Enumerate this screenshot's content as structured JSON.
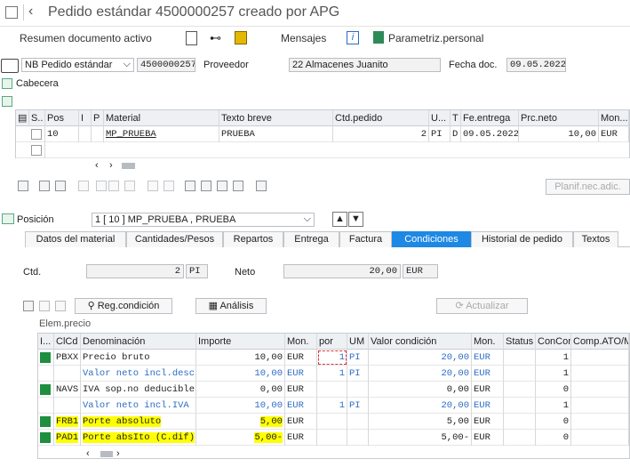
{
  "header": {
    "title": "Pedido estándar 4500000257 creado por APG"
  },
  "toolbar": {
    "resumen": "Resumen documento activo",
    "mensajes": "Mensajes",
    "parametriz": "Parametriz.personal"
  },
  "header_fields": {
    "doc_type": "NB Pedido estándar",
    "doc_number": "4500000257",
    "vendor_label": "Proveedor",
    "vendor_value": "22 Almacenes Juanito",
    "date_label": "Fecha doc.",
    "date_value": "09.05.2022",
    "cabecera": "Cabecera"
  },
  "items_table": {
    "columns": [
      "S..",
      "Pos",
      "I",
      "P",
      "Material",
      "Texto breve",
      "Ctd.pedido",
      "U...",
      "T",
      "Fe.entrega",
      "Prc.neto",
      "Mon..."
    ],
    "rows": [
      {
        "pos": "10",
        "material": "MP_PRUEBA",
        "texto": "PRUEBA",
        "ctd": "2",
        "u": "PI",
        "t": "D",
        "fecha": "09.05.2022",
        "precio": "10,00",
        "mon": "EUR"
      }
    ],
    "planif": "Planif.nec.adic."
  },
  "position": {
    "label": "Posición",
    "value": "1 [ 10 ] MP_PRUEBA , PRUEBA"
  },
  "tabs": [
    "Datos del material",
    "Cantidades/Pesos",
    "Repartos",
    "Entrega",
    "Factura",
    "Condiciones",
    "Historial de pedido",
    "Textos"
  ],
  "active_tab": "Condiciones",
  "conditions": {
    "ctd_label": "Ctd.",
    "ctd_value": "2",
    "ctd_unit": "PI",
    "neto_label": "Neto",
    "neto_value": "20,00",
    "neto_unit": "EUR",
    "reg_condicion": "Reg.condición",
    "analisis": "Análisis",
    "actualizar": "Actualizar",
    "elem_precio": "Elem.precio",
    "columns": [
      "I...",
      "ClCd",
      "Denominación",
      "Importe",
      "Mon.",
      "por",
      "UM",
      "Valor condición",
      "Mon.",
      "Status",
      "ConCon",
      "Comp.ATO/M"
    ],
    "rows": [
      {
        "green": true,
        "yellow": false,
        "clcd": "PBXX",
        "den": "Precio bruto",
        "imp": "10,00",
        "mon": "EUR",
        "por": "1",
        "um": "PI",
        "valor": "20,00",
        "mon2": "EUR",
        "concon": "1",
        "blue": false,
        "blueval": true
      },
      {
        "green": false,
        "yellow": false,
        "clcd": "",
        "den": "Valor neto incl.desc",
        "imp": "10,00",
        "mon": "EUR",
        "por": "1",
        "um": "PI",
        "valor": "20,00",
        "mon2": "EUR",
        "concon": "1",
        "blue": true,
        "blueval": true
      },
      {
        "green": true,
        "yellow": false,
        "clcd": "NAVS",
        "den": "IVA sop.no deducible",
        "imp": "0,00",
        "mon": "EUR",
        "por": "",
        "um": "",
        "valor": "0,00",
        "mon2": "EUR",
        "concon": "0",
        "blue": false,
        "blueval": false
      },
      {
        "green": false,
        "yellow": false,
        "clcd": "",
        "den": "Valor neto incl.IVA",
        "imp": "10,00",
        "mon": "EUR",
        "por": "1",
        "um": "PI",
        "valor": "20,00",
        "mon2": "EUR",
        "concon": "1",
        "blue": true,
        "blueval": true
      },
      {
        "green": true,
        "yellow": true,
        "clcd": "FRB1",
        "den": "Porte absoluto",
        "imp": "5,00",
        "mon": "EUR",
        "por": "",
        "um": "",
        "valor": "5,00",
        "mon2": "EUR",
        "concon": "0",
        "blue": false,
        "blueval": false
      },
      {
        "green": true,
        "yellow": true,
        "clcd": "PAD1",
        "den": "Porte absIto (C.dif)",
        "imp": "5,00-",
        "mon": "EUR",
        "por": "",
        "um": "",
        "valor": "5,00-",
        "mon2": "EUR",
        "concon": "0",
        "blue": false,
        "blueval": false
      }
    ]
  }
}
